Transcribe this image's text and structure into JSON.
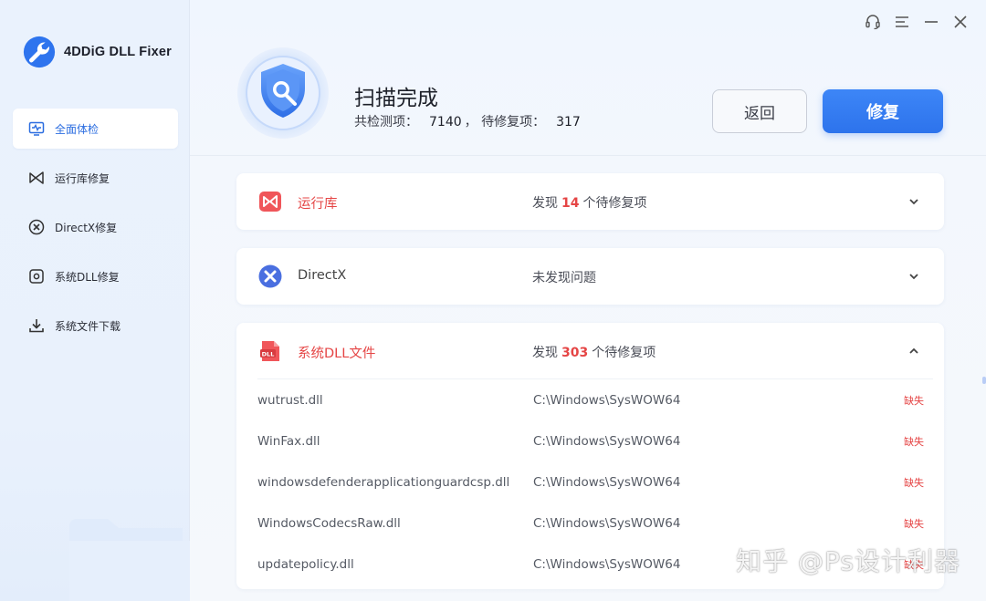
{
  "app": {
    "name": "4DDiG DLL Fixer"
  },
  "sidebar": {
    "items": [
      {
        "label": "全面体检",
        "icon": "monitor-pulse-icon",
        "active": true
      },
      {
        "label": "运行库修复",
        "icon": "runtime-bow-icon",
        "active": false
      },
      {
        "label": "DirectX修复",
        "icon": "directx-x-icon",
        "active": false
      },
      {
        "label": "系统DLL修复",
        "icon": "dll-gear-icon",
        "active": false
      },
      {
        "label": "系统文件下载",
        "icon": "download-icon",
        "active": false
      }
    ]
  },
  "window_controls": [
    "headset-icon",
    "menu-icon",
    "minimize-icon",
    "close-icon"
  ],
  "header": {
    "title": "扫描完成",
    "checked_label": "共检测项：",
    "checked_count": "7140",
    "separator": "，",
    "pending_label": "待修复项：",
    "pending_count": "317",
    "back_label": "返回",
    "repair_label": "修复"
  },
  "categories": [
    {
      "name": "运行库",
      "status_prefix": "发现",
      "count": "14",
      "status_suffix": "个待修复项",
      "status_plain": "",
      "expanded": false
    },
    {
      "name": "DirectX",
      "status_prefix": "",
      "count": "",
      "status_suffix": "",
      "status_plain": "未发现问题",
      "expanded": false
    },
    {
      "name": "系统DLL文件",
      "status_prefix": "发现",
      "count": "303",
      "status_suffix": "个待修复项",
      "status_plain": "",
      "expanded": true
    }
  ],
  "dll_rows": [
    {
      "name": "wutrust.dll",
      "path": "C:\\Windows\\SysWOW64",
      "state": "缺失"
    },
    {
      "name": "WinFax.dll",
      "path": "C:\\Windows\\SysWOW64",
      "state": "缺失"
    },
    {
      "name": "windowsdefenderapplicationguardcsp.dll",
      "path": "C:\\Windows\\SysWOW64",
      "state": "缺失"
    },
    {
      "name": "WindowsCodecsRaw.dll",
      "path": "C:\\Windows\\SysWOW64",
      "state": "缺失"
    },
    {
      "name": "updatepolicy.dll",
      "path": "C:\\Windows\\SysWOW64",
      "state": "缺失"
    }
  ],
  "watermark": "知乎 @Ps设计利器",
  "colors": {
    "accent": "#2d73ec",
    "danger": "#e54545",
    "sidebar_bg": "#eaf2fd"
  }
}
